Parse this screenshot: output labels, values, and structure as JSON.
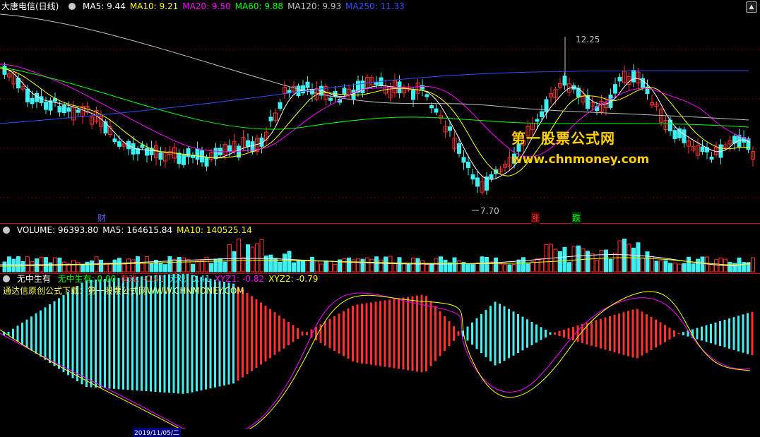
{
  "main_panel": {
    "stock_name": "大唐电信(日线)",
    "ma_items": [
      {
        "label": "MA5: 9.44",
        "color": "#ffffff"
      },
      {
        "label": "MA10: 9.21",
        "color": "#ffff00"
      },
      {
        "label": "MA20: 9.50",
        "color": "#ff00ff"
      },
      {
        "label": "MA60: 9.88",
        "color": "#00ff00"
      },
      {
        "label": "MA120: 9.93",
        "color": "#c0c0c0"
      },
      {
        "label": "MA250: 11.33",
        "color": "#3050ff"
      }
    ],
    "high_label": "12.25",
    "low_label": "7.70",
    "tag_cai": "财",
    "tag_zhang": "涨",
    "tag_die": "跌"
  },
  "volume_panel": {
    "items": [
      {
        "label": "VOLUME: 96393.80",
        "color": "#ffffff"
      },
      {
        "label": "MA5: 164615.84",
        "color": "#ffffff"
      },
      {
        "label": "MA10: 140525.14",
        "color": "#ffff00"
      }
    ]
  },
  "indicator_panel": {
    "name": "无中生有",
    "items": [
      {
        "label": "无中生有: 0.00",
        "color": "#00ff00"
      },
      {
        "label": "有戏: -0.41",
        "color": "#ff3030"
      },
      {
        "label": "无戏: 0.41",
        "color": "#40f0f0"
      },
      {
        "label": "XYZ1: -0.82",
        "color": "#ff00ff"
      },
      {
        "label": "XYZ2: -0.79",
        "color": "#ffff00"
      }
    ],
    "note": "通达信原创公式下载：第一股票公式网WWW.CHNMONEY.COM"
  },
  "watermark": {
    "title": "第一股票公式网",
    "url": "www.chnmoney.com"
  },
  "date_bar": {
    "date_label": "2019/11/05/二"
  },
  "colors": {
    "up": "#ff3030",
    "down": "#40f0f0",
    "grid": "#b00000",
    "ma5": "#ffffff",
    "ma10": "#ffff00",
    "ma20": "#ff00ff",
    "ma60": "#00ff00",
    "ma120": "#c0c0c0",
    "ma250": "#3050ff"
  }
}
